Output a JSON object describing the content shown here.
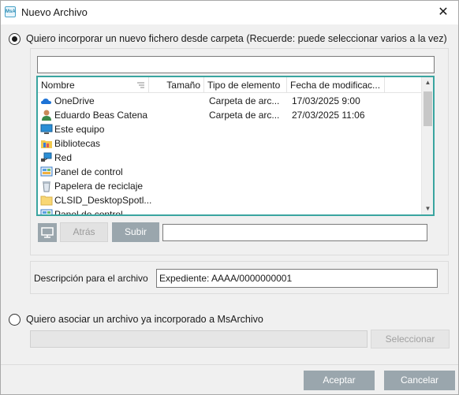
{
  "window": {
    "title": "Nuevo Archivo",
    "app_icon_text": "MsA",
    "close_glyph": "✕"
  },
  "option_folder": {
    "label": "Quiero incorporar un nuevo fichero desde carpeta (Recuerde: puede seleccionar varios a la vez)",
    "selected": true,
    "path_value": ""
  },
  "file_list": {
    "columns": [
      "Nombre",
      "Tamaño",
      "Tipo de elemento",
      "Fecha de modificac..."
    ],
    "rows": [
      {
        "name": "OneDrive",
        "size": "",
        "type": "Carpeta de arc...",
        "date": "17/03/2025 9:00",
        "icon": "onedrive-cloud-icon"
      },
      {
        "name": "Eduardo Beas Catena",
        "size": "",
        "type": "Carpeta de arc...",
        "date": "27/03/2025 11:06",
        "icon": "user-folder-icon"
      },
      {
        "name": "Este equipo",
        "size": "",
        "type": "",
        "date": "",
        "icon": "computer-icon"
      },
      {
        "name": "Bibliotecas",
        "size": "",
        "type": "",
        "date": "",
        "icon": "libraries-icon"
      },
      {
        "name": "Red",
        "size": "",
        "type": "",
        "date": "",
        "icon": "network-icon"
      },
      {
        "name": "Panel de control",
        "size": "",
        "type": "",
        "date": "",
        "icon": "control-panel-icon"
      },
      {
        "name": "Papelera de reciclaje",
        "size": "",
        "type": "",
        "date": "",
        "icon": "recycle-bin-icon"
      },
      {
        "name": "CLSID_DesktopSpotl...",
        "size": "",
        "type": "",
        "date": "",
        "icon": "folder-icon"
      },
      {
        "name": "Panel de control",
        "size": "",
        "type": "",
        "date": "",
        "icon": "control-panel-icon"
      }
    ]
  },
  "nav": {
    "back_label": "Atrás",
    "up_label": "Subir",
    "current_path": ""
  },
  "description": {
    "label": "Descripción para el archivo",
    "value": "Expediente: AAAA/0000000001"
  },
  "option_existing": {
    "label": "Quiero asociar un archivo ya incorporado a MsArchivo",
    "selected": false,
    "value": "",
    "select_label": "Seleccionar"
  },
  "footer": {
    "accept_label": "Aceptar",
    "cancel_label": "Cancelar"
  },
  "colors": {
    "accent": "#3aa5a0",
    "button": "#9aa6ad"
  }
}
